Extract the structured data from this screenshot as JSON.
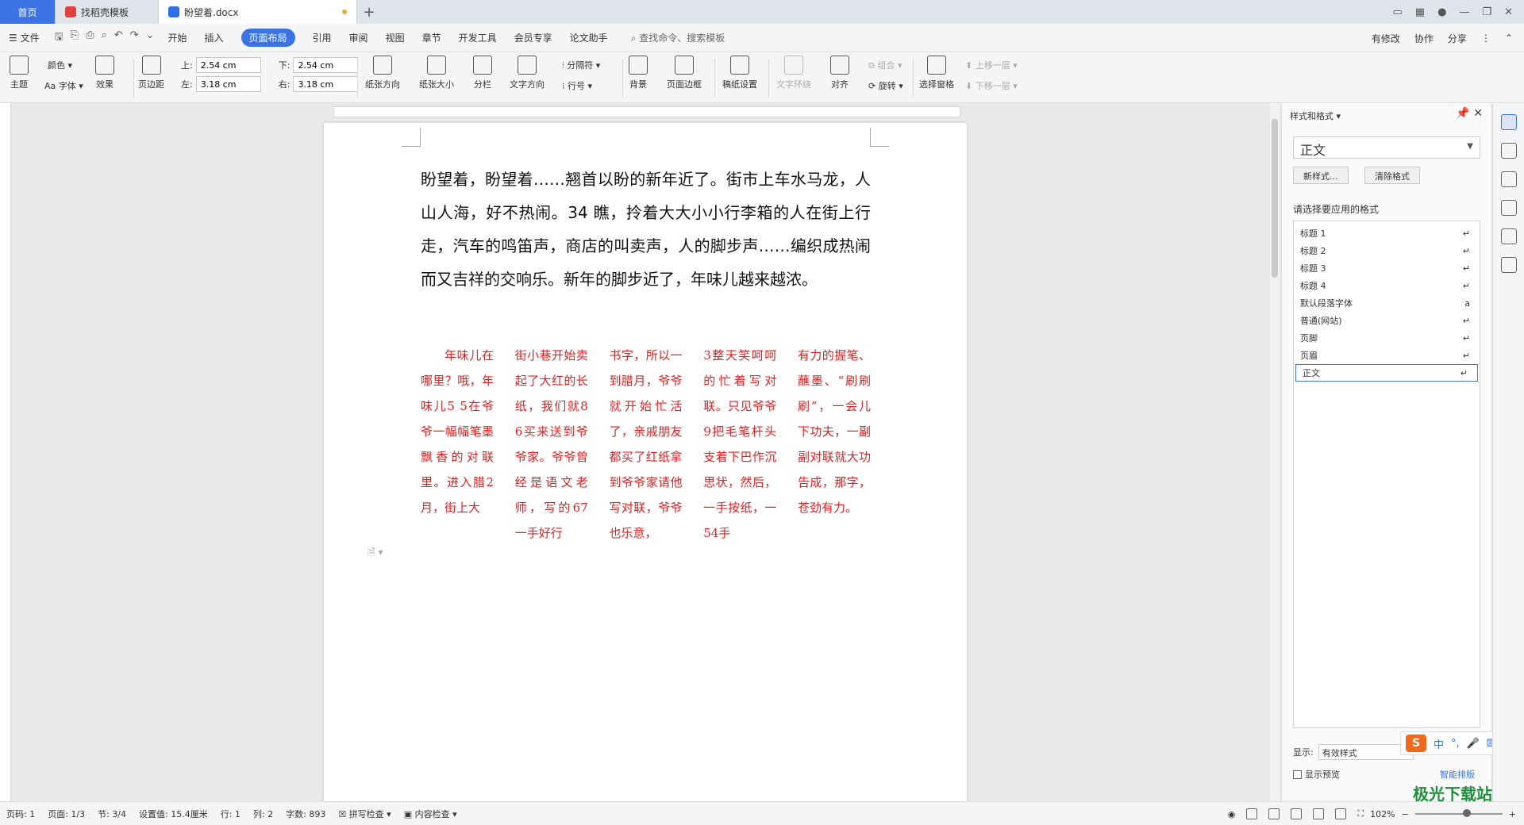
{
  "tabs": {
    "home": "首页",
    "template": "找稻壳模板",
    "document": "盼望着.docx"
  },
  "menu": {
    "file": "文件",
    "items": [
      "开始",
      "插入",
      "页面布局",
      "引用",
      "审阅",
      "视图",
      "章节",
      "开发工具",
      "会员专享",
      "论文助手"
    ],
    "active": "页面布局",
    "search": "查找命令、搜索模板",
    "right": [
      "有修改",
      "协作",
      "分享"
    ]
  },
  "ribbon": {
    "theme": "主题",
    "color": "颜色",
    "font": "Aa 字体",
    "effect": "效果",
    "margin": "页边距",
    "top_label": "上:",
    "top": "2.54 cm",
    "bottom_label": "下:",
    "bottom": "2.54 cm",
    "left_label": "左:",
    "left": "3.18 cm",
    "right_label": "右:",
    "right": "3.18 cm",
    "orientation": "纸张方向",
    "size": "纸张大小",
    "columns": "分栏",
    "text_dir": "文字方向",
    "separator": "分隔符",
    "line_no": "行号",
    "background": "背景",
    "page_border": "页面边框",
    "grid_paper": "稿纸设置",
    "wrap": "文字环绕",
    "align": "对齐",
    "group": "组合",
    "rotate": "旋转",
    "select_pane": "选择窗格",
    "bring_up": "上移一层",
    "send_down": "下移一层"
  },
  "document": {
    "paragraph": "盼望着，盼望着……翘首以盼的新年近了。街市上车水马龙，人山人海，好不热闹。34 瞧，拎着大大小小行李箱的人在街上行走，汽车的鸣笛声，商店的叫卖声，人的脚步声……编织成热闹而又吉祥的交响乐。新年的脚步近了，年味儿越来越浓。",
    "columns": [
      "年味儿在哪里？哦，年味儿5 5在爷爷一幅幅笔墨飘香的对联里。进入腊2月，街上大",
      "街小巷开始卖起了大红的长纸，我们就86买来送到爷爷家。爷爷曾经是语文老师，写的67一手好行",
      "书字，所以一到腊月，爷爷就开始忙活了，亲戚朋友都买了红纸拿到爷爷家请他写对联，爷爷也乐意，",
      "3整天笑呵呵的忙着写对联。只见爷爷9把毛笔杆头支着下巴作沉思状，然后，一手按纸，一54手",
      "有力的握笔、蘸墨、“刷刷刷”，一会儿下功夫，一副副对联就大功告成，那字，苍劲有力。"
    ]
  },
  "panel": {
    "title": "样式和格式",
    "current": "正文",
    "new_style": "新样式...",
    "clear": "清除格式",
    "hint": "请选择要应用的格式",
    "styles": [
      "标题 1",
      "标题 2",
      "标题 3",
      "标题 4",
      "默认段落字体",
      "普通(网站)",
      "页脚",
      "页眉",
      "正文"
    ],
    "show_label": "显示:",
    "show_value": "有效样式",
    "preview": "显示预览",
    "smart": "智能排版"
  },
  "status": {
    "page_code": "页码: 1",
    "page": "页面: 1/3",
    "section": "节: 3/4",
    "setting": "设置值: 15.4厘米",
    "row": "行: 1",
    "col": "列: 2",
    "words": "字数: 893",
    "spell": "拼写检查",
    "content": "内容检查",
    "zoom": "102%"
  },
  "ime": {
    "logo": "S",
    "lang": "中"
  },
  "watermark": "极光下载站"
}
